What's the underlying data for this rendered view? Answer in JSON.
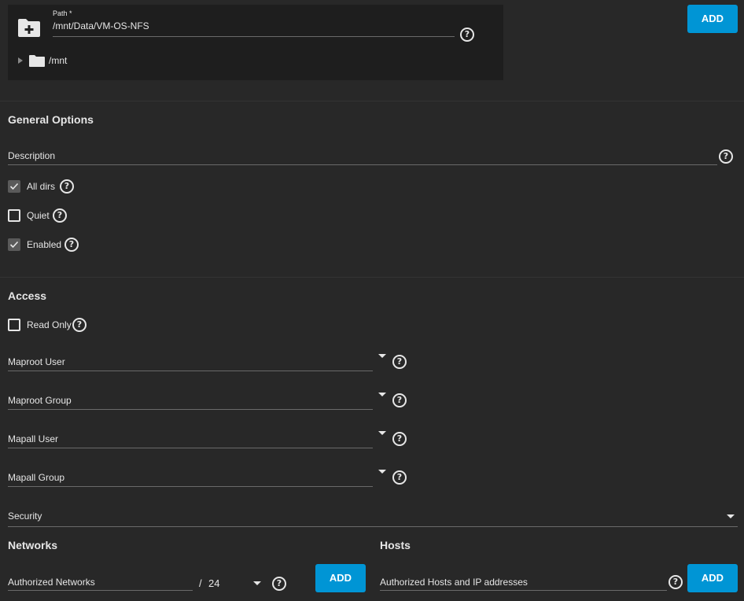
{
  "explorer": {
    "path_label": "Path *",
    "path_value": "/mnt/Data/VM-OS-NFS",
    "tree_root": "/mnt",
    "help": "?"
  },
  "top_add": "ADD",
  "general": {
    "title": "General Options",
    "description_label": "Description",
    "all_dirs": "All dirs",
    "all_dirs_checked": true,
    "quiet": "Quiet",
    "quiet_checked": false,
    "enabled": "Enabled",
    "enabled_checked": true,
    "help": "?"
  },
  "access": {
    "title": "Access",
    "read_only": "Read Only",
    "read_only_checked": false,
    "maproot_user": "Maproot User",
    "maproot_group": "Maproot Group",
    "mapall_user": "Mapall User",
    "mapall_group": "Mapall Group",
    "security": "Security",
    "help": "?"
  },
  "networks": {
    "title": "Networks",
    "authorized_label": "Authorized Networks",
    "slash": "/",
    "mask": "24",
    "add": "ADD",
    "help": "?"
  },
  "hosts": {
    "title": "Hosts",
    "authorized_label": "Authorized Hosts and IP addresses",
    "add": "ADD",
    "help": "?"
  },
  "colors": {
    "background": "#282828",
    "panel": "#1e1e1e",
    "accent": "#0095d5",
    "text": "#e6e6e6"
  }
}
